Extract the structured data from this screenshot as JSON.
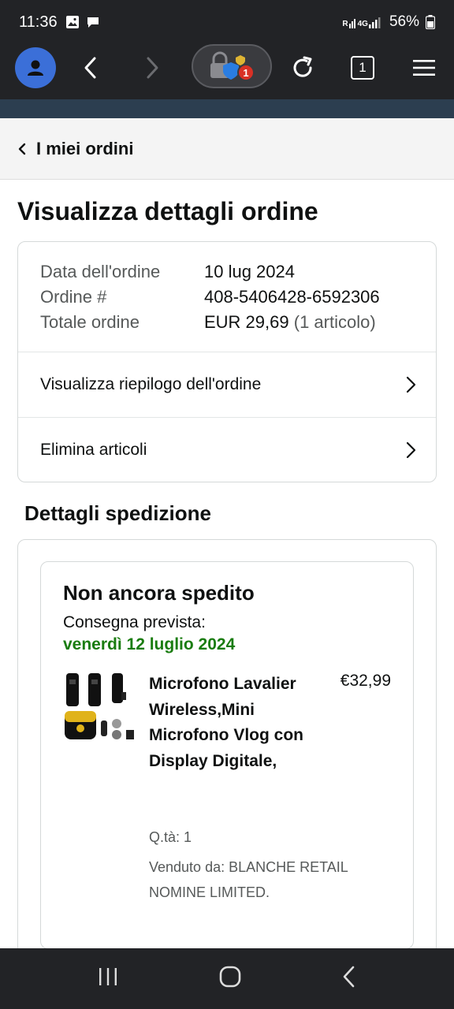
{
  "status": {
    "time": "11:36",
    "battery": "56%",
    "net_r": "R",
    "net_4g": "4G"
  },
  "browser": {
    "tab_count": "1",
    "badge_count": "1"
  },
  "breadcrumb": {
    "label": "I miei ordini"
  },
  "page": {
    "title": "Visualizza dettagli ordine"
  },
  "order": {
    "date_label": "Data dell'ordine",
    "date_value": "10 lug 2024",
    "number_label": "Ordine #",
    "number_value": "408-5406428-6592306",
    "total_label": "Totale ordine",
    "total_value": "EUR 29,69",
    "total_items": "(1 articolo)",
    "summary_link": "Visualizza riepilogo dell'ordine",
    "delete_link": "Elimina articoli"
  },
  "shipping": {
    "section_title": "Dettagli spedizione",
    "status": "Non ancora spedito",
    "delivery_label": "Consegna prevista:",
    "delivery_date": "venerdì 12 luglio 2024",
    "item": {
      "title": "Microfono Lavalier Wireless,Mini Microfono Vlog con Display Digitale,",
      "price": "€32,99",
      "qty": "Q.tà: 1",
      "seller": "Venduto da: BLANCHE RETAIL NOMINE LIMITED."
    }
  },
  "colors": {
    "delivery_green": "#1a7c10",
    "avatar_blue": "#3b6fd8",
    "band": "#2c3e50"
  }
}
